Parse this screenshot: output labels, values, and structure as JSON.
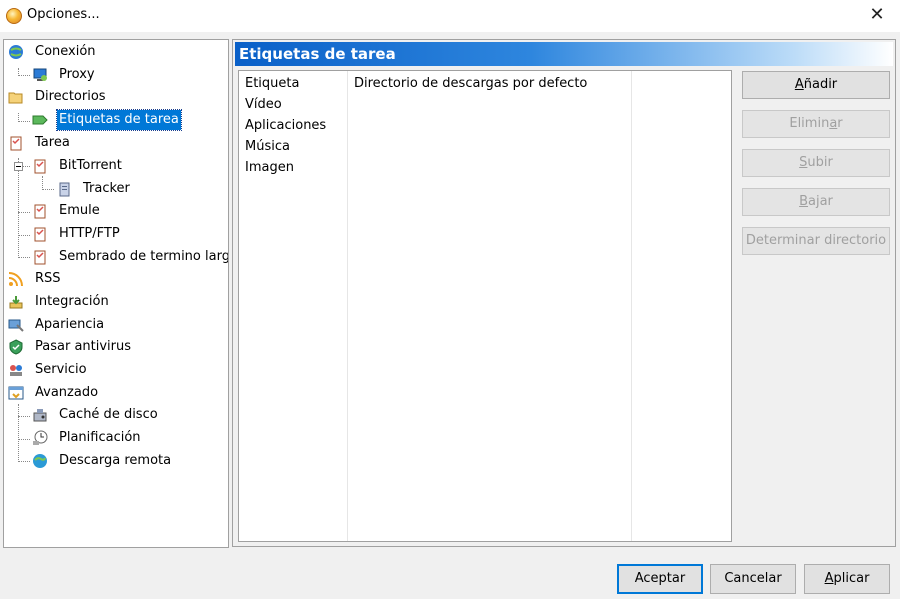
{
  "window": {
    "title": "Opciones...",
    "close_glyph": "✕"
  },
  "tree": [
    {
      "label": "Conexión",
      "icon": "globe-network-icon"
    },
    {
      "label": "Proxy",
      "icon": "proxy-icon"
    },
    {
      "label": "Directorios",
      "icon": "folder-icon"
    },
    {
      "label": "Etiquetas de tarea",
      "icon": "tag-icon",
      "selected": true
    },
    {
      "label": "Tarea",
      "icon": "task-clipboard-icon"
    },
    {
      "label": "BitTorrent",
      "icon": "task-clipboard-icon"
    },
    {
      "label": "Tracker",
      "icon": "server-icon"
    },
    {
      "label": "Emule",
      "icon": "task-clipboard-icon"
    },
    {
      "label": "HTTP/FTP",
      "icon": "task-clipboard-icon"
    },
    {
      "label": "Sembrado de termino largo",
      "icon": "task-clipboard-icon"
    },
    {
      "label": "RSS",
      "icon": "rss-icon"
    },
    {
      "label": "Integración",
      "icon": "integration-icon"
    },
    {
      "label": "Apariencia",
      "icon": "appearance-icon"
    },
    {
      "label": "Pasar antivirus",
      "icon": "antivirus-shield-icon"
    },
    {
      "label": "Servicio",
      "icon": "service-icon"
    },
    {
      "label": "Avanzado",
      "icon": "advanced-icon"
    },
    {
      "label": "Caché de disco",
      "icon": "disk-cache-icon"
    },
    {
      "label": "Planificación",
      "icon": "schedule-icon"
    },
    {
      "label": "Descarga remota",
      "icon": "remote-download-globe-icon"
    }
  ],
  "panel": {
    "title": "Etiquetas de tarea"
  },
  "list": {
    "items": [
      "Etiqueta",
      "Vídeo",
      "Aplicaciones",
      "Música",
      "Imagen"
    ],
    "value_header": "Directorio de descargas por defecto"
  },
  "side_buttons": {
    "add": {
      "pre": "",
      "ul": "A",
      "post": "ñadir"
    },
    "delete": {
      "pre": "Elimin",
      "ul": "a",
      "post": "r"
    },
    "up": {
      "pre": "",
      "ul": "S",
      "post": "ubir"
    },
    "down": {
      "pre": "",
      "ul": "B",
      "post": "ajar"
    },
    "set_dir": {
      "label": "Determinar directorio"
    }
  },
  "footer": {
    "accept": "Aceptar",
    "cancel": "Cancelar",
    "apply": {
      "pre": "",
      "ul": "A",
      "post": "plicar"
    }
  },
  "colors": {
    "selection": "#0078d7",
    "header_gradient_start": "#0a60c8"
  }
}
